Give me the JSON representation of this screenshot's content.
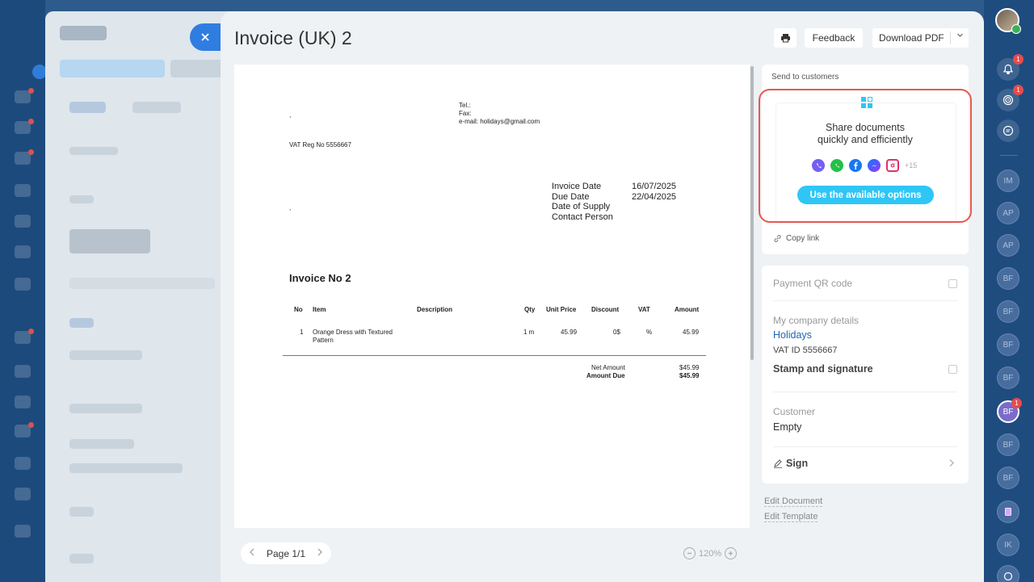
{
  "modal": {
    "title": "Invoice (UK) 2",
    "feedback_label": "Feedback",
    "download_label": "Download PDF"
  },
  "document": {
    "comma1": ",",
    "tel": "Tel.:",
    "fax": "Fax:",
    "email": "e-mail: holidays@gmail.com",
    "vat_reg": "VAT Reg No 5556667",
    "comma2": ",",
    "meta_labels": [
      "Invoice Date",
      "Due Date",
      "Date of Supply",
      "Contact Person"
    ],
    "meta_values": [
      "16/07/2025",
      "22/04/2025"
    ],
    "invoice_title": "Invoice No 2",
    "columns": [
      "No",
      "Item",
      "Description",
      "Qty",
      "Unit Price",
      "Discount",
      "VAT",
      "Amount"
    ],
    "row": {
      "no": "1",
      "item_line1": "Orange Dress with Textured",
      "item_line2": "Pattern",
      "qty": "1 m",
      "unit_price": "45.99",
      "discount": "0$",
      "vat": "%",
      "amount": "45.99"
    },
    "net_label": "Net Amount",
    "net_value": "$45.99",
    "due_label": "Amount Due",
    "due_value": "$45.99"
  },
  "pager": {
    "label": "Page 1/1"
  },
  "zoom": {
    "level": "120%"
  },
  "send": {
    "label": "Send to customers",
    "share_line1": "Share documents",
    "share_line2": "quickly and efficiently",
    "more_count": "+15",
    "use_button": "Use the available options",
    "copy_link": "Copy link"
  },
  "details": {
    "payment_qr": "Payment QR code",
    "company_label": "My company details",
    "company_name": "Holidays",
    "vat_id": "VAT ID 5556667",
    "stamp": "Stamp and signature",
    "customer_label": "Customer",
    "customer_value": "Empty",
    "sign": "Sign"
  },
  "links": {
    "edit_document": "Edit Document",
    "edit_template": "Edit Template"
  },
  "right_bar": {
    "notifications_badge": "1",
    "goals_badge": "1",
    "avatar_badge": "1",
    "avatars": [
      "IM",
      "AP",
      "AP",
      "BF",
      "BF",
      "BF",
      "BF",
      "BF",
      "BF",
      "BF",
      "IK"
    ]
  },
  "colors": {
    "accent": "#2fc6f6",
    "close": "#2f7de0",
    "highlight": "#e8584f",
    "link": "#2066b0"
  }
}
